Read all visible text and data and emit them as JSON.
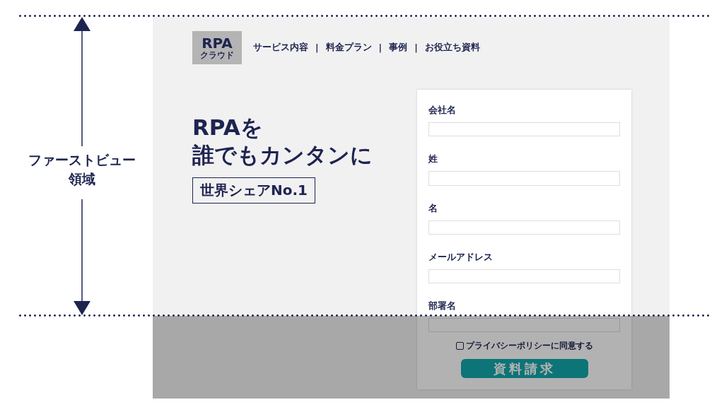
{
  "annotation": {
    "label_lines": [
      "ファーストビュー",
      "領域"
    ]
  },
  "header": {
    "logo": {
      "title": "RPA",
      "subtitle": "クラウド"
    },
    "nav": [
      {
        "label": "サービス内容"
      },
      {
        "label": "料金プラン"
      },
      {
        "label": "事例"
      },
      {
        "label": "お役立ち資料"
      }
    ],
    "separator": "|"
  },
  "hero": {
    "headline_lines": [
      "RPAを",
      "誰でもカンタンに"
    ],
    "badge": "世界シェアNo.1"
  },
  "form": {
    "fields": [
      {
        "label": "会社名"
      },
      {
        "label": "姓"
      },
      {
        "label": "名"
      },
      {
        "label": "メールアドレス"
      },
      {
        "label": "部署名"
      }
    ],
    "privacy": {
      "label": "プライバシーポリシーに同意する",
      "checked": false
    },
    "submit": "資料請求"
  }
}
